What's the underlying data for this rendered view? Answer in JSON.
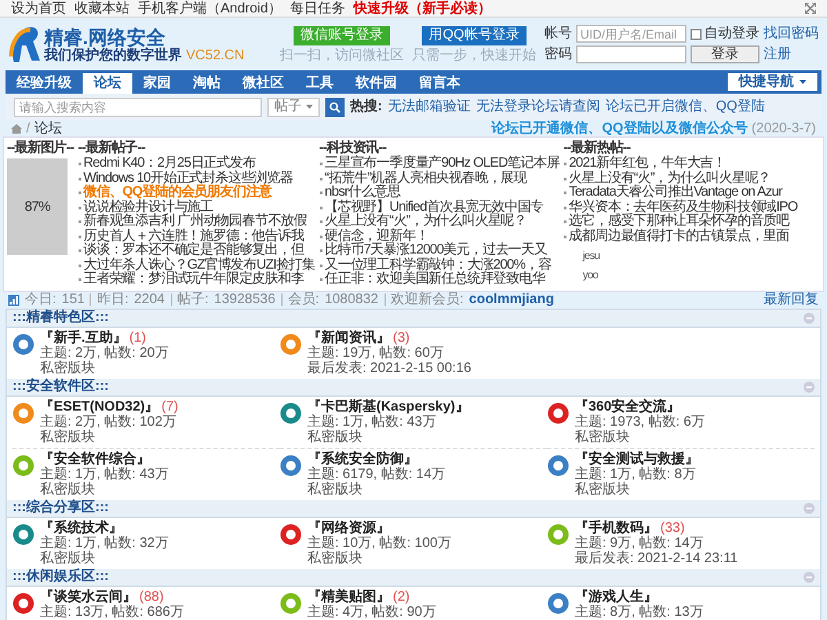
{
  "topbar": {
    "links": [
      {
        "label": "设为首页",
        "highlighted": false
      },
      {
        "label": "收藏本站",
        "highlighted": false
      },
      {
        "label": "手机客户端（Android）",
        "highlighted": false
      },
      {
        "label": "每日任务",
        "highlighted": false
      },
      {
        "label": "快速升级（新手必读）",
        "highlighted": true
      }
    ]
  },
  "logo": {
    "title": "精睿.网络安全",
    "slogan": "我们保护您的数字世界",
    "domain": "VC52.CN"
  },
  "social_login": [
    {
      "kind": "wechat",
      "label": "微信账号登录",
      "hint": "扫一扫，访问微社区"
    },
    {
      "kind": "qq",
      "label": "用QQ帐号登录",
      "hint": "只需一步，快速开始"
    }
  ],
  "login": {
    "account_label": "帐号",
    "account_placeholder": "UID/用户名/Email",
    "auto_login": {
      "label": "自动登录",
      "checked": false
    },
    "forgot": "找回密码",
    "password_label": "密码",
    "submit": "登录",
    "register": "注册"
  },
  "nav": {
    "items": [
      {
        "label": "经验升级",
        "selected": false
      },
      {
        "label": "论坛",
        "selected": true
      },
      {
        "label": "家园",
        "selected": false
      },
      {
        "label": "淘帖",
        "selected": false
      },
      {
        "label": "微社区",
        "selected": false
      },
      {
        "label": "工具",
        "selected": false
      },
      {
        "label": "软件园",
        "selected": false
      },
      {
        "label": "留言本",
        "selected": false
      }
    ],
    "quick_nav": "快捷导航"
  },
  "search": {
    "placeholder": "请输入搜索内容",
    "type": "帖子",
    "hot_label": "热搜:",
    "hot": [
      "无法邮箱验证",
      "无法登录论坛请查阅",
      "论坛已开启微信、QQ登陆"
    ]
  },
  "breadcrumb": {
    "separator": "/",
    "current": "论坛"
  },
  "announcement": {
    "text": "论坛已开通微信、QQ登陆以及微信公众号",
    "date": "(2020-3-7)"
  },
  "news": {
    "image_title": "--最新图片--",
    "image_caption": "87%",
    "columns": [
      {
        "title": "--最新帖子--",
        "items": [
          {
            "text": "Redmi K40：2月25日正式发布",
            "highlighted": false
          },
          {
            "text": "Windows 10开始正式封杀这些浏览器",
            "highlighted": false
          },
          {
            "text": "微信、QQ登陆的会员朋友们注意",
            "highlighted": true
          },
          {
            "text": "说说检验井设计与施工",
            "highlighted": false
          },
          {
            "text": "新春观鱼添吉利 广州动物园春节不放假",
            "highlighted": false
          },
          {
            "text": "历史首人＋六连胜！施罗德：他告诉我",
            "highlighted": false
          },
          {
            "text": "谈谈：罗本还不确定是否能够复出，但",
            "highlighted": false
          },
          {
            "text": "大过年杀人诛心？GZ官博发布UZI捡打集",
            "highlighted": false
          },
          {
            "text": "王者荣耀：梦泪试玩牛年限定皮肤和李",
            "highlighted": false
          }
        ]
      },
      {
        "title": "--科技资讯--",
        "items": [
          {
            "text": "三星宣布一季度量产90Hz OLED笔记本屏",
            "highlighted": false
          },
          {
            "text": "“拓荒牛”机器人亮相央视春晚，展现",
            "highlighted": false
          },
          {
            "text": "nbsr什么意思",
            "highlighted": false
          },
          {
            "text": "【芯视野】Unified首次县宽无效中国专",
            "highlighted": false
          },
          {
            "text": "火星上没有“火”，为什么叫火星呢？",
            "highlighted": false
          },
          {
            "text": "硬信念，迎新年！",
            "highlighted": false
          },
          {
            "text": "比特币7天暴涨12000美元，过去一天又",
            "highlighted": false
          },
          {
            "text": "又一位理工科学霸敲钟：大涨200%，容",
            "highlighted": false
          },
          {
            "text": "任正非：欢迎美国新任总统拜登致电华",
            "highlighted": false
          }
        ]
      },
      {
        "title": "--最新热帖--",
        "items": [
          {
            "text": "2021新年红包，牛年大吉！",
            "highlighted": false
          },
          {
            "text": "火星上没有“火”，为什么叫火星呢？",
            "highlighted": false
          },
          {
            "text": "Teradata天睿公司推出Vantage on Azur",
            "highlighted": false
          },
          {
            "text": "华兴资本：去年医药及生物科技领域IPO",
            "highlighted": false
          },
          {
            "text": "选它，感受下那种让耳朵怀孕的音质吧",
            "highlighted": false
          },
          {
            "text": "成都周边最值得打卡的古镇景点，里面",
            "highlighted": false
          }
        ],
        "extra": [
          "jesu",
          "yoo"
        ]
      }
    ]
  },
  "stats": [
    {
      "label": "今日:",
      "value": "151"
    },
    {
      "label": "昨日:",
      "value": "2204"
    },
    {
      "label": "帖子:",
      "value": "13928536"
    },
    {
      "label": "会员:",
      "value": "1080832"
    },
    {
      "label": "欢迎新会员:",
      "value": "coolmmjiang"
    }
  ],
  "latest_reply": "最新回复",
  "sections": [
    {
      "title": ":::精睿特色区:::",
      "expanded": true,
      "forums": [
        {
          "name": "『新手.互助』",
          "count": "(1)",
          "lines": [
            "主题: 2万, 帖数: 20万",
            "私密版块"
          ]
        },
        {
          "name": "『新闻资讯』",
          "count": "(3)",
          "lines": [
            "主题: 19万, 帖数: 60万",
            "最后发表: 2021-2-15 00:16"
          ]
        }
      ]
    },
    {
      "title": ":::安全软件区:::",
      "expanded": true,
      "forums": [
        {
          "name": "『ESET(NOD32)』",
          "count": "(7)",
          "lines": [
            "主题: 2万, 帖数: 102万",
            "私密版块"
          ]
        },
        {
          "name": "『卡巴斯基(Kaspersky)』",
          "lines": [
            "主题: 1万, 帖数: 43万",
            "私密版块"
          ]
        },
        {
          "name": "『360安全交流』",
          "lines": [
            "主题: 1973, 帖数: 6万",
            "私密版块"
          ]
        },
        {
          "name": "『安全软件综合』",
          "lines": [
            "主题: 1万, 帖数: 43万",
            "私密版块"
          ]
        },
        {
          "name": "『系统安全防御』",
          "lines": [
            "主题: 6179, 帖数: 14万",
            "私密版块"
          ]
        },
        {
          "name": "『安全测试与救援』",
          "lines": [
            "主题: 1万, 帖数: 8万",
            "私密版块"
          ]
        }
      ]
    },
    {
      "title": ":::综合分享区:::",
      "expanded": true,
      "forums": [
        {
          "name": "『系统技术』",
          "lines": [
            "主题: 1万, 帖数: 32万",
            "私密版块"
          ]
        },
        {
          "name": "『网络资源』",
          "lines": [
            "主题: 10万, 帖数: 100万",
            "私密版块"
          ]
        },
        {
          "name": "『手机数码』",
          "count": "(33)",
          "lines": [
            "主题: 9万, 帖数: 14万",
            "最后发表: 2021-2-14 23:11"
          ]
        }
      ]
    },
    {
      "title": ":::休闲娱乐区:::",
      "expanded": true,
      "forums": [
        {
          "name": "『谈笑水云间』",
          "count": "(88)",
          "lines": [
            "主题: 13万, 帖数: 686万"
          ]
        },
        {
          "name": "『精美贴图』",
          "count": "(2)",
          "lines": [
            "主题: 4万, 帖数: 90万"
          ]
        },
        {
          "name": "『游戏人生』",
          "lines": [
            "主题: 8万, 帖数: 13万"
          ]
        }
      ]
    }
  ]
}
